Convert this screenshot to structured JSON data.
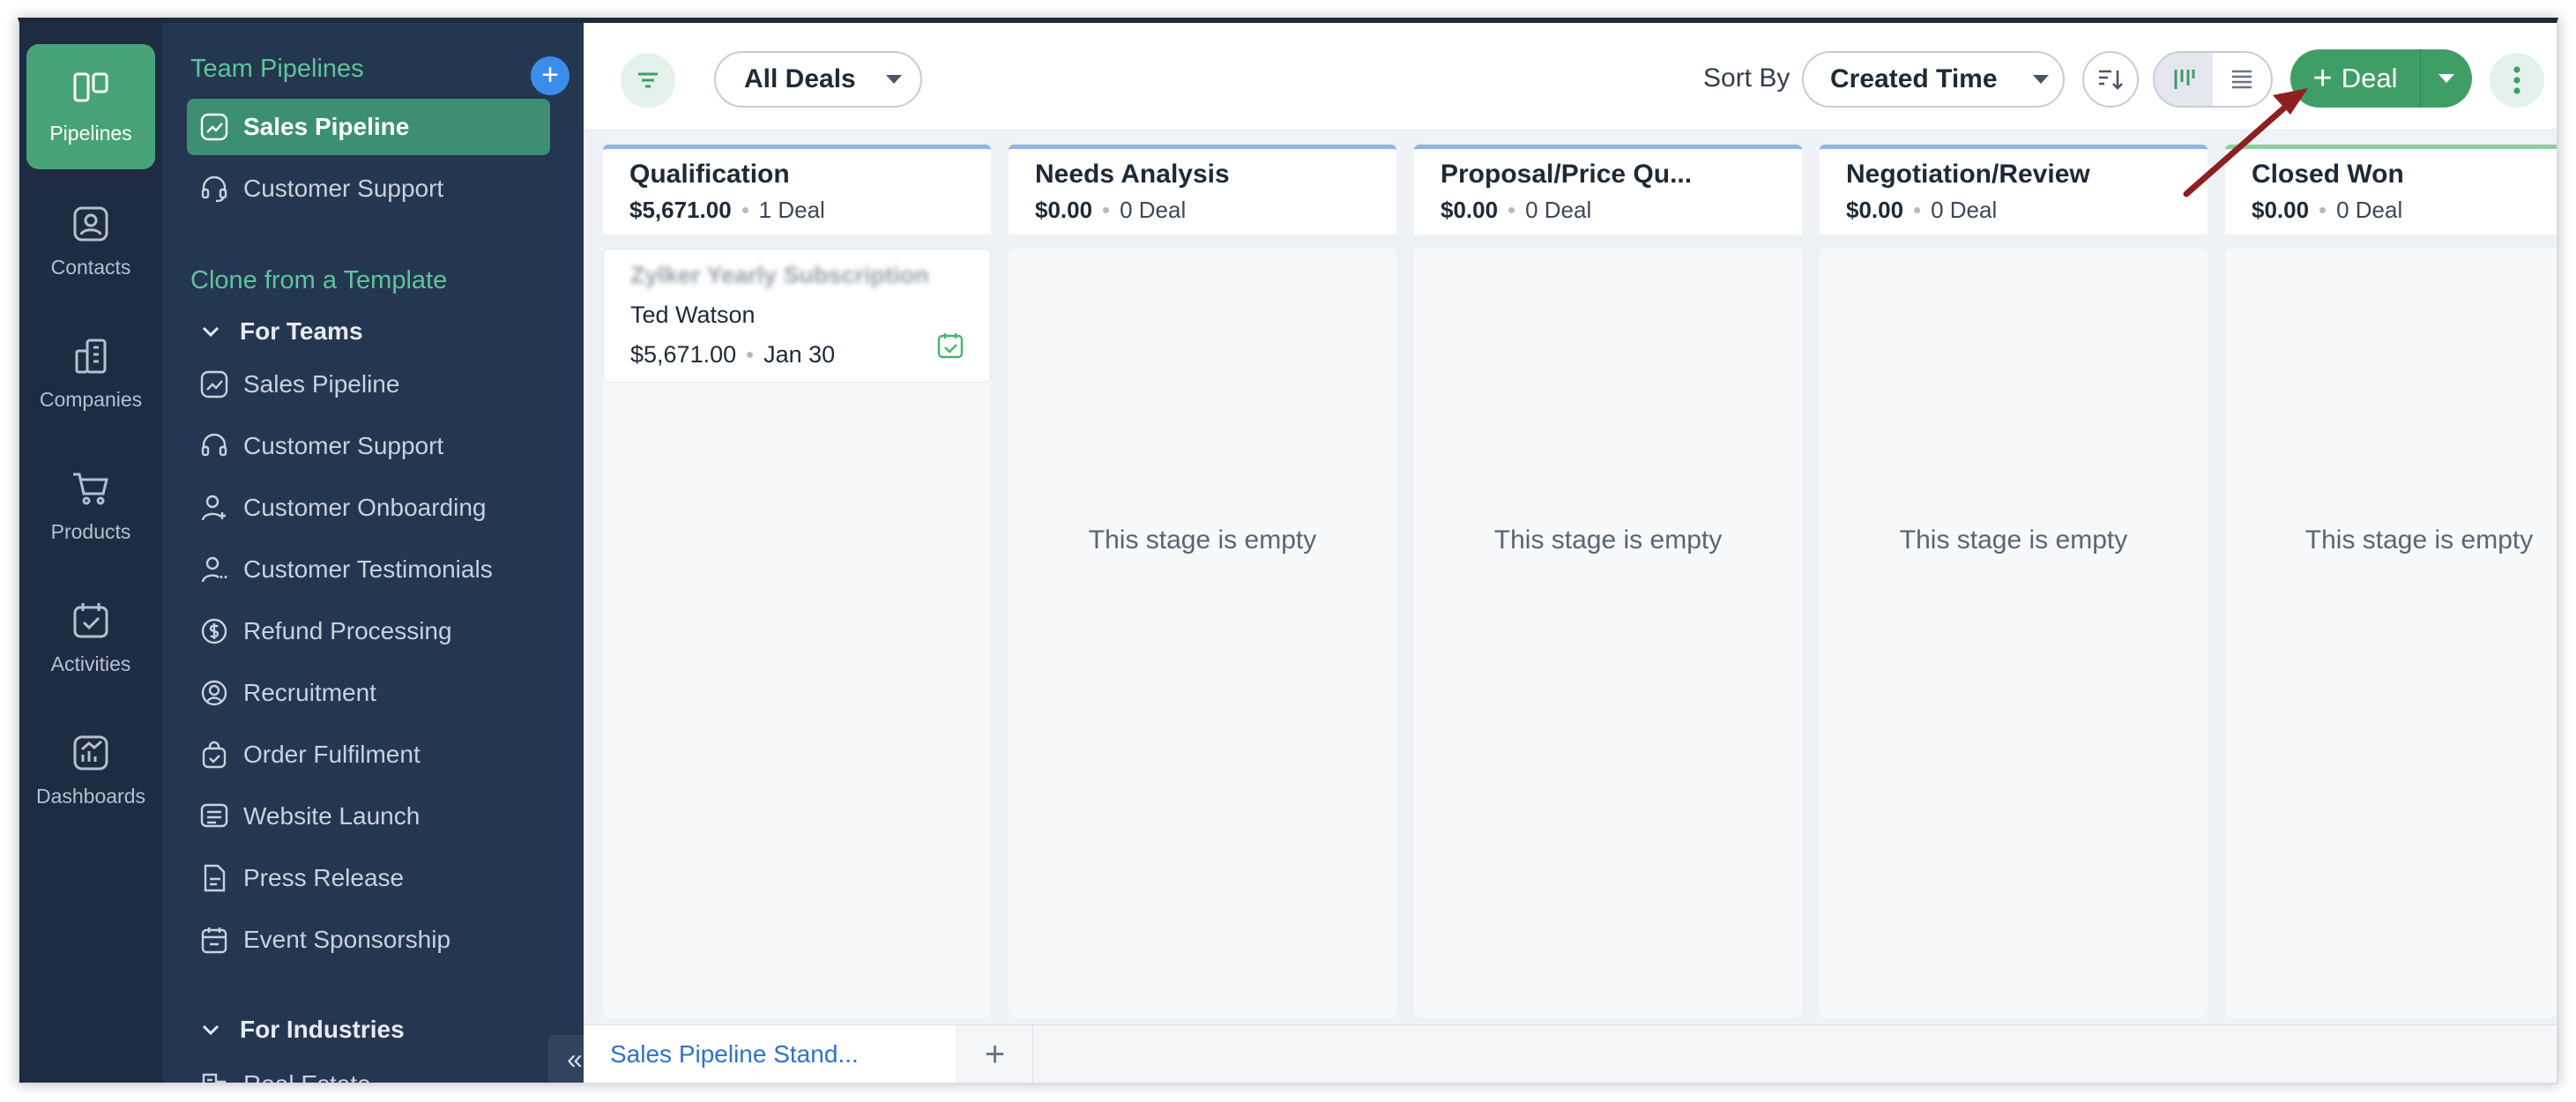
{
  "rail": {
    "items": [
      {
        "label": "Pipelines",
        "icon": "pipelines-icon",
        "active": true
      },
      {
        "label": "Contacts",
        "icon": "contacts-icon"
      },
      {
        "label": "Companies",
        "icon": "companies-icon"
      },
      {
        "label": "Products",
        "icon": "products-icon"
      },
      {
        "label": "Activities",
        "icon": "activities-icon"
      },
      {
        "label": "Dashboards",
        "icon": "dashboards-icon"
      }
    ]
  },
  "sidebar": {
    "team_title": "Team Pipelines",
    "team_items": [
      "Sales Pipeline",
      "Customer Support"
    ],
    "clone_title": "Clone from a Template",
    "for_teams": "For Teams",
    "template_items": [
      "Sales Pipeline",
      "Customer Support",
      "Customer Onboarding",
      "Customer Testimonials",
      "Refund Processing",
      "Recruitment",
      "Order Fulfilment",
      "Website Launch",
      "Press Release",
      "Event Sponsorship"
    ],
    "for_industries": "For Industries",
    "industry_items": [
      "Real Estate"
    ],
    "collapse": "«"
  },
  "toolbar": {
    "view_select": "All Deals",
    "sort_label": "Sort By",
    "sort_select": "Created Time",
    "deal_button": "Deal",
    "accent": "#3f9e66"
  },
  "stages": [
    {
      "title": "Qualification",
      "amount": "$5,671.00",
      "count": "1 Deal"
    },
    {
      "title": "Needs Analysis",
      "amount": "$0.00",
      "count": "0 Deal",
      "empty": "This stage is empty"
    },
    {
      "title": "Proposal/Price Qu...",
      "amount": "$0.00",
      "count": "0 Deal",
      "empty": "This stage is empty"
    },
    {
      "title": "Negotiation/Review",
      "amount": "$0.00",
      "count": "0 Deal",
      "empty": "This stage is empty"
    },
    {
      "title": "Closed Won",
      "amount": "$0.00",
      "count": "0 Deal",
      "empty": "This stage is empty"
    }
  ],
  "card": {
    "title": "Zylker Yearly Subscription",
    "contact": "Ted Watson",
    "amount": "$5,671.00",
    "date": "Jan 30"
  },
  "tabs": {
    "active": "Sales Pipeline Stand...",
    "add": "+"
  }
}
